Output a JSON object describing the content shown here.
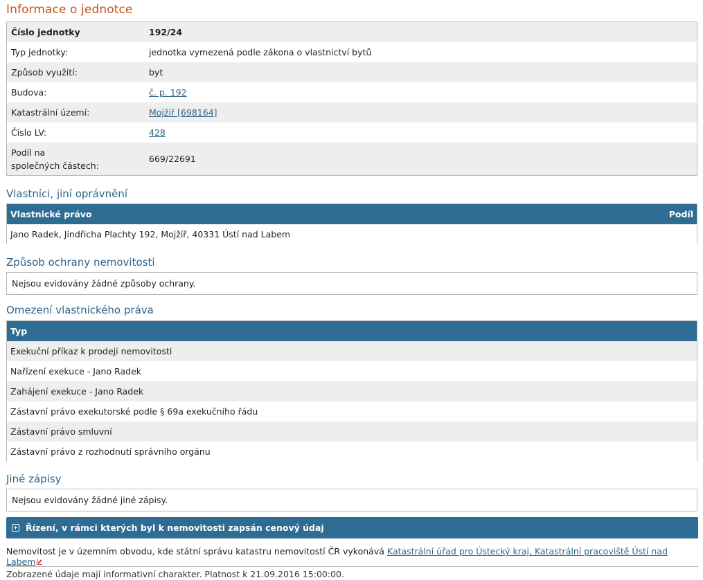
{
  "title": "Informace o jednotce",
  "info": {
    "rows": [
      {
        "label": "Číslo jednotky",
        "value": "192/24",
        "bold": true
      },
      {
        "label": "Typ jednotky:",
        "value": "jednotka vymezená podle zákona o vlastnictví bytů"
      },
      {
        "label": "Způsob využití:",
        "value": "byt"
      },
      {
        "label": "Budova:",
        "value": "č. p. 192",
        "link": true
      },
      {
        "label": "Katastrální území:",
        "value": "Mojžíř [698164]",
        "link": true
      },
      {
        "label": "Číslo LV:",
        "value": "428",
        "link": true
      }
    ],
    "share_label_1": "Podíl na",
    "share_label_2": "společných částech:",
    "share_value": "669/22691"
  },
  "owners": {
    "heading": "Vlastníci, jiní oprávnění",
    "col1": "Vlastnické právo",
    "col2": "Podíl",
    "rows": [
      "Jano Radek, Jindřicha Plachty 192, Mojžíř, 40331 Ústí nad Labem"
    ]
  },
  "protection": {
    "heading": "Způsob ochrany nemovitosti",
    "text": "Nejsou evidovány žádné způsoby ochrany."
  },
  "restrictions": {
    "heading": "Omezení vlastnického práva",
    "col": "Typ",
    "rows": [
      "Exekuční příkaz k prodeji nemovitosti",
      "Nařízení exekuce - Jano Radek",
      "Zahájení exekuce - Jano Radek",
      "Zástavní právo exekutorské podle § 69a exekučního řádu",
      "Zástavní právo smluvní",
      "Zástavní právo z rozhodnutí správního orgánu"
    ]
  },
  "other": {
    "heading": "Jiné zápisy",
    "text": "Nejsou evidovány žádné jiné zápisy."
  },
  "proceedings": {
    "label": "Řízení, v rámci kterých byl k nemovitosti zapsán cenový údaj"
  },
  "note": {
    "text": "Nemovitost je v územním obvodu, kde státní správu katastru nemovitostí ČR vykonává",
    "link": "Katastrální úřad pro Ústecký kraj, Katastrální pracoviště Ústí nad Labem"
  },
  "footer": "Zobrazené údaje mají informativní charakter. Platnost k 21.09.2016 15:00:00.",
  "colors": {
    "header_bg": "#2e6c94",
    "title": "#c0541a",
    "heading": "#2d6488"
  }
}
